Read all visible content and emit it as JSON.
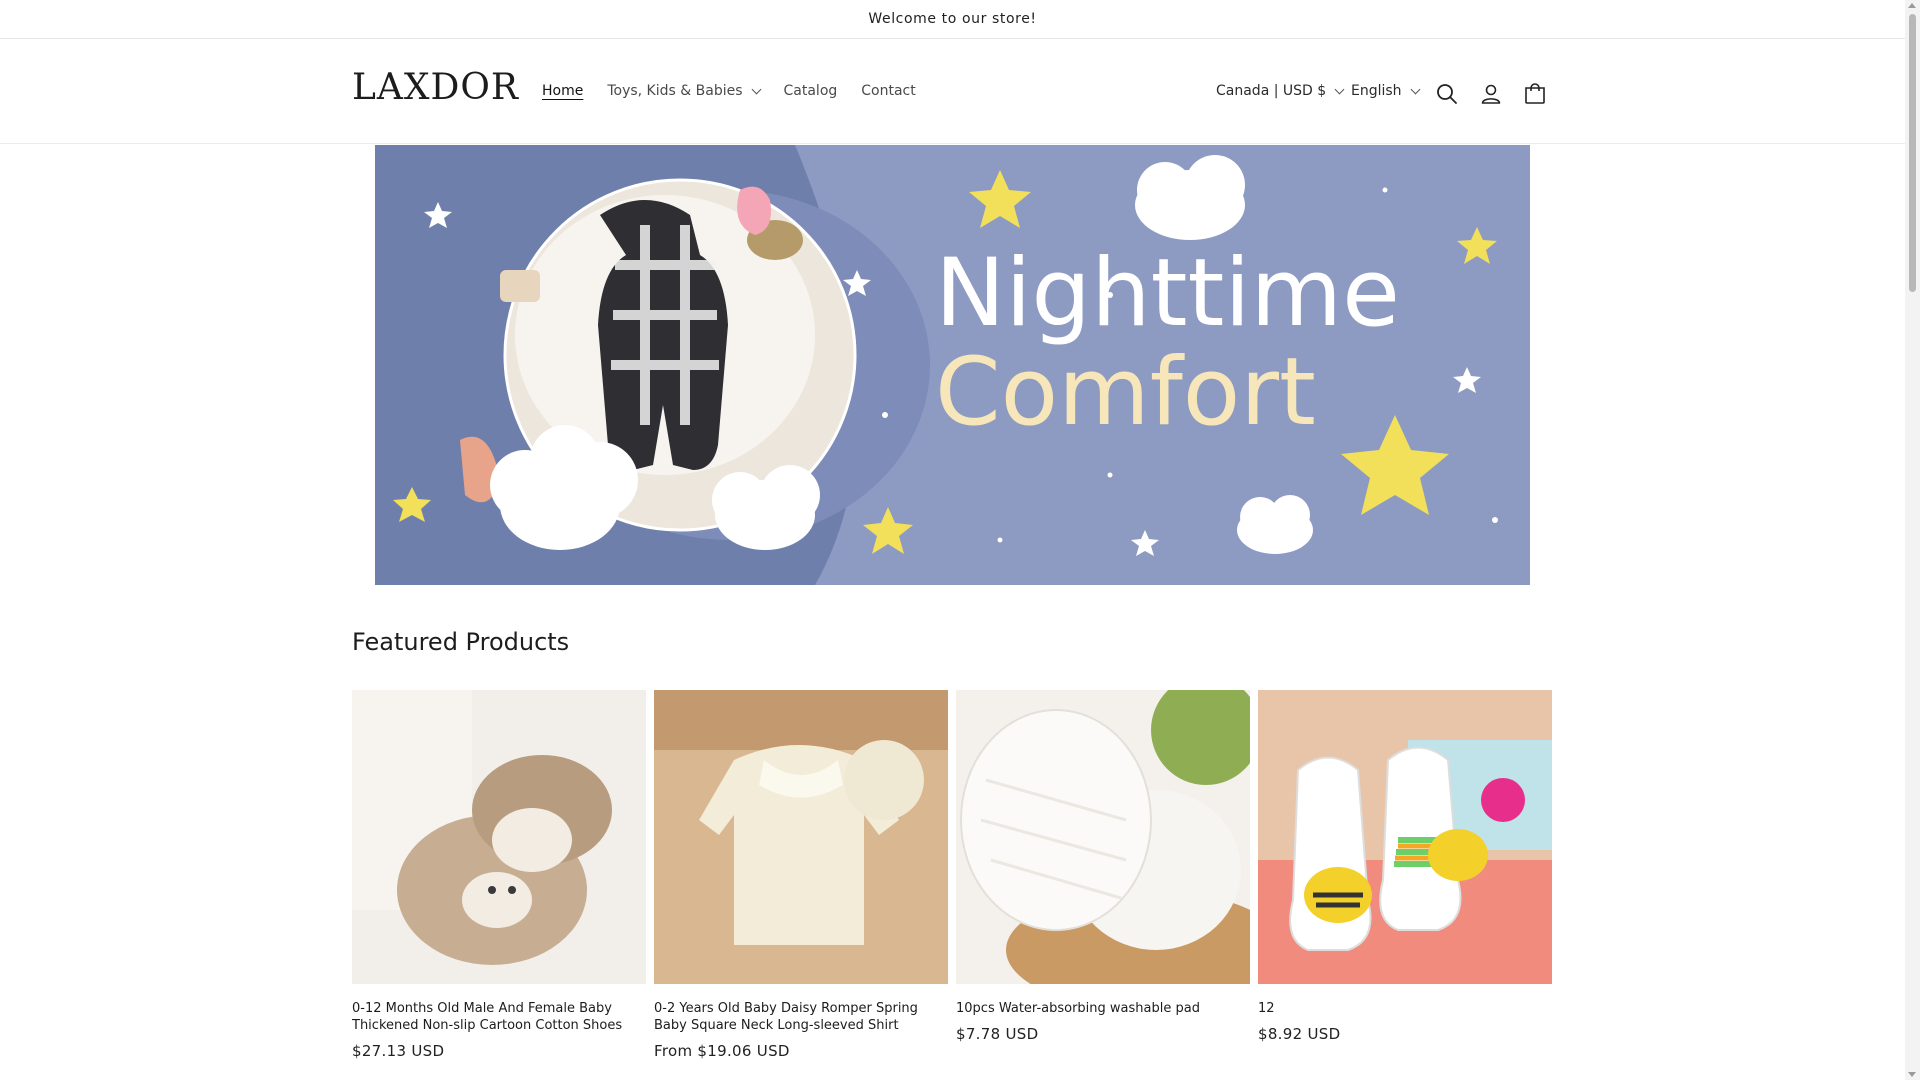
{
  "announcement": {
    "text": "Welcome to our store!"
  },
  "header": {
    "logo": "LAXDOR",
    "nav": [
      {
        "label": "Home",
        "active": true
      },
      {
        "label": "Toys, Kids & Babies",
        "has_dropdown": true
      },
      {
        "label": "Catalog"
      },
      {
        "label": "Contact"
      }
    ],
    "country_selector": "Canada | USD $",
    "language_selector": "English",
    "icons": [
      "search-icon",
      "account-icon",
      "cart-icon"
    ]
  },
  "banner": {
    "line1": "Nighttime",
    "line2": "Comfort",
    "background_color": "#8d9bc2"
  },
  "featured": {
    "title": "Featured Products",
    "products": [
      {
        "title": "0-12 Months Old Male And Female Baby Thickened Non-slip Cartoon Cotton Shoes",
        "price": "$27.13 USD"
      },
      {
        "title": "0-2 Years Old Baby Daisy Romper Spring Baby Square Neck Long-sleeved Shirt",
        "price": "From $19.06 USD"
      },
      {
        "title": "10pcs Water-absorbing washable pad",
        "price": "$7.78 USD"
      },
      {
        "title": "12",
        "price": "$8.92 USD"
      }
    ]
  }
}
